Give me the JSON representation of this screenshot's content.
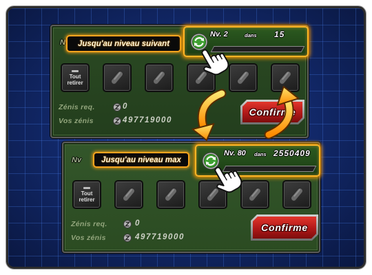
{
  "panels": [
    {
      "nv_label": "Nv",
      "tag": "Jusqu'au niveau suivant",
      "level": "Nv. 2",
      "dans": "dans",
      "remaining": "15",
      "progress": 0,
      "remove_all": {
        "line1": "Tout",
        "line2": "retirer"
      },
      "slot_icons": [
        "capsule-icon",
        "capsule-icon",
        "capsule-icon",
        "capsule-icon",
        "capsule-icon"
      ],
      "zenis_req_label": "Zénis req.",
      "zenis_req_value": "0",
      "vos_zenis_label": "Vos zénis",
      "vos_zenis_value": "497719000",
      "confirm_label": "Confirme"
    },
    {
      "nv_label": "Nv",
      "tag": "Jusqu'au niveau max",
      "level": "Nv. 80",
      "dans": "dans",
      "remaining": "2550409",
      "progress": 0,
      "remove_all": {
        "line1": "Tout",
        "line2": "retirer"
      },
      "slot_icons": [
        "capsule-icon",
        "capsule-icon",
        "capsule-icon",
        "capsule-icon",
        "capsule-icon"
      ],
      "zenis_req_label": "Zénis req.",
      "zenis_req_value": "0",
      "vos_zenis_label": "Vos zénis",
      "vos_zenis_value": "497719000",
      "confirm_label": "Confirme"
    }
  ],
  "icons": {
    "level_toggle": "cycle-arrows-icon",
    "currency": "zeni-coin-icon",
    "slot_item": "capsule-icon",
    "remove_all": "dash-icon",
    "pointer": "hand-pointer-icon",
    "transition": "curved-arrow-icon"
  },
  "colors": {
    "highlight": "#ffa41c",
    "confirm": "#c4201c",
    "panel": "#2f5123",
    "background": "#12296b"
  }
}
